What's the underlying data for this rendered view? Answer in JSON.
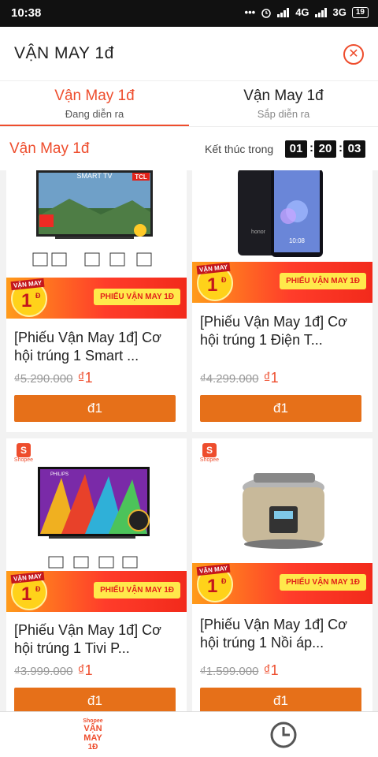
{
  "status": {
    "time": "10:38",
    "dots": "•••",
    "network1": "4G",
    "network2": "3G",
    "battery": "19"
  },
  "header": {
    "title": "VẬN MAY 1đ",
    "close_icon": "close-circle-icon"
  },
  "tabs": [
    {
      "label": "Vận May 1đ",
      "sublabel": "Đang diễn ra",
      "active": true
    },
    {
      "label": "Vận May 1đ",
      "sublabel": "Sắp diễn ra",
      "active": false
    }
  ],
  "section": {
    "title": "Vận May 1đ",
    "end_label": "Kết thúc trong",
    "countdown": [
      "01",
      "20",
      "03"
    ]
  },
  "banner": {
    "badge_top": "VẬN MAY",
    "badge_num": "1",
    "badge_unit": "Đ",
    "pill": "PHIẾU VẬN MAY 1Đ"
  },
  "shopee_mini": {
    "icon": "S",
    "label": "Shopee"
  },
  "products": [
    {
      "name": "[Phiếu Vận May 1đ] Cơ hội trúng 1 Smart ...",
      "old_price": "₫5.290.000",
      "new_price": "₫1",
      "button": "đ1",
      "image": "smart-tv-image",
      "img_text": "SMART TV",
      "img_brand": "TCL"
    },
    {
      "name": "[Phiếu Vận May 1đ] Cơ hội trúng 1 Điện T...",
      "old_price": "₫4.299.000",
      "new_price": "₫1",
      "button": "đ1",
      "image": "honor-phone-image",
      "img_text": "honor",
      "img_brand": "10:08"
    },
    {
      "name": "[Phiếu Vận May 1đ] Cơ hội trúng 1 Tivi P...",
      "old_price": "₫3.999.000",
      "new_price": "₫1",
      "button": "đ1",
      "image": "philips-tv-image",
      "img_text": "PHILIPS",
      "img_brand": ""
    },
    {
      "name": "[Phiếu Vận May 1đ] Cơ hội trúng 1 Nồi áp...",
      "old_price": "₫1.599.000",
      "new_price": "₫1",
      "button": "đ1",
      "image": "pressure-cooker-image",
      "img_text": "",
      "img_brand": ""
    }
  ],
  "bottom_nav": {
    "logo_a": "Shopee",
    "logo_b": "VẬN MAY",
    "logo_c": "1Đ",
    "history_icon": "clock-icon"
  },
  "colors": {
    "accent": "#ee4d2d",
    "button": "#e67019",
    "banner_yellow": "#ffe94b"
  }
}
